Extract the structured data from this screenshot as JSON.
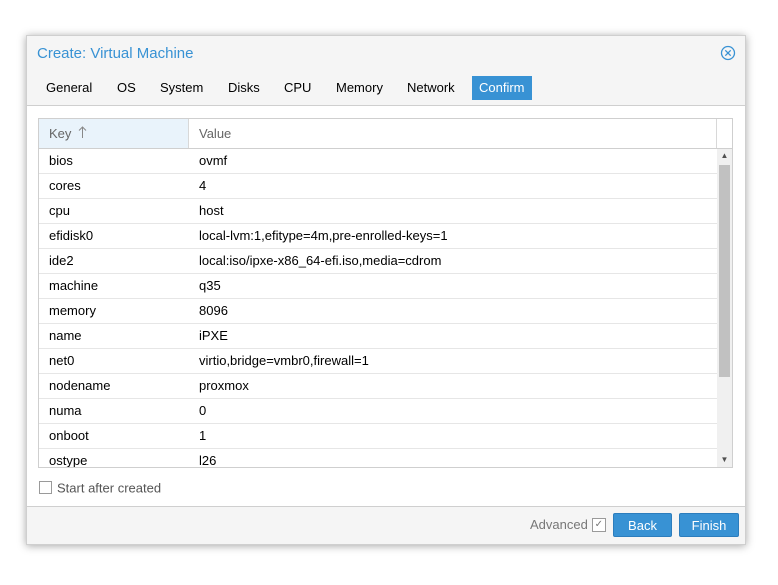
{
  "dialog": {
    "title": "Create: Virtual Machine",
    "close_icon": "close-circle-icon"
  },
  "tabs": [
    {
      "label": "General",
      "active": false
    },
    {
      "label": "OS",
      "active": false
    },
    {
      "label": "System",
      "active": false
    },
    {
      "label": "Disks",
      "active": false
    },
    {
      "label": "CPU",
      "active": false
    },
    {
      "label": "Memory",
      "active": false
    },
    {
      "label": "Network",
      "active": false
    },
    {
      "label": "Confirm",
      "active": true
    }
  ],
  "grid": {
    "columns": {
      "key": "Key",
      "value": "Value"
    },
    "sort_icon": "sort-ascending-arrow-icon",
    "rows": [
      {
        "key": "bios",
        "value": "ovmf"
      },
      {
        "key": "cores",
        "value": "4"
      },
      {
        "key": "cpu",
        "value": "host"
      },
      {
        "key": "efidisk0",
        "value": "local-lvm:1,efitype=4m,pre-enrolled-keys=1"
      },
      {
        "key": "ide2",
        "value": "local:iso/ipxe-x86_64-efi.iso,media=cdrom"
      },
      {
        "key": "machine",
        "value": "q35"
      },
      {
        "key": "memory",
        "value": "8096"
      },
      {
        "key": "name",
        "value": "iPXE"
      },
      {
        "key": "net0",
        "value": "virtio,bridge=vmbr0,firewall=1"
      },
      {
        "key": "nodename",
        "value": "proxmox"
      },
      {
        "key": "numa",
        "value": "0"
      },
      {
        "key": "onboot",
        "value": "1"
      },
      {
        "key": "ostype",
        "value": "l26"
      }
    ]
  },
  "start_after_created": {
    "label": "Start after created",
    "checked": false
  },
  "footer": {
    "advanced_label": "Advanced",
    "advanced_checked": true,
    "back_label": "Back",
    "finish_label": "Finish"
  },
  "colors": {
    "accent": "#3892d4",
    "header_key_bg": "#e9f3fb"
  }
}
